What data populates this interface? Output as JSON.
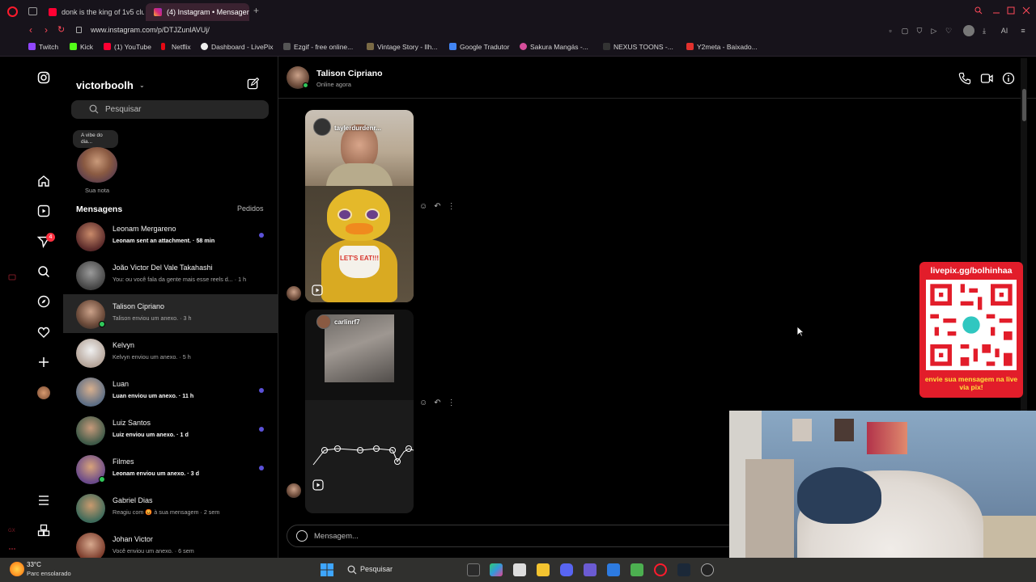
{
  "browser": {
    "tabs": [
      {
        "label": "donk is the king of 1v5 clu",
        "active": false
      },
      {
        "label": "(4) Instagram • Mensagen",
        "active": true
      }
    ],
    "url": "www.instagram.com/p/DTJZunlAVUj/",
    "ext_label": "AI",
    "bookmarks": [
      "Twitch",
      "Kick",
      "(1) YouTube",
      "Netflix",
      "Dashboard - LivePix",
      "Ezgif - free online...",
      "Vintage Story - Ilh...",
      "Google Tradutor",
      "Sakura Mangás -...",
      "NEXUS TOONS -...",
      "Y2meta - Baixado..."
    ]
  },
  "nav": {
    "notification_count": "4"
  },
  "inbox": {
    "username": "victorboolh",
    "search_placeholder": "Pesquisar",
    "note_text": "A vibe do dia...",
    "note_label": "Sua nota",
    "section_title": "Mensagens",
    "requests_label": "Pedidos",
    "conversations": [
      {
        "name": "Leonam Mergareno",
        "preview": "Leonam sent an attachment. · 58 min",
        "unread": true,
        "online": false,
        "selected": false
      },
      {
        "name": "João Victor Del Vale Takahashi",
        "preview": "You: ou você fala da gente mais esse reels d... · 1 h",
        "unread": false,
        "online": false,
        "selected": false
      },
      {
        "name": "Talison Cipriano",
        "preview": "Talison enviou um anexo. · 3 h",
        "unread": false,
        "online": true,
        "selected": true
      },
      {
        "name": "Kelvyn",
        "preview": "Kelvyn enviou um anexo. · 5 h",
        "unread": false,
        "online": false,
        "selected": false
      },
      {
        "name": "Luan",
        "preview": "Luan enviou um anexo. · 11 h",
        "unread": true,
        "online": false,
        "selected": false
      },
      {
        "name": "Luiz Santos",
        "preview": "Luiz enviou um anexo. · 1 d",
        "unread": true,
        "online": false,
        "selected": false
      },
      {
        "name": "Filmes",
        "preview": "Leonam enviou um anexo. · 3 d",
        "unread": true,
        "online": true,
        "selected": false
      },
      {
        "name": "Gabriel Dias",
        "preview": "Reagiu com 😡 à sua mensagem · 2 sem",
        "unread": false,
        "online": false,
        "selected": false
      },
      {
        "name": "Johan Victor",
        "preview": "Você enviou um anexo. · 6 sem",
        "unread": false,
        "online": false,
        "selected": false
      }
    ]
  },
  "chat": {
    "contact_name": "Talison Cipriano",
    "contact_status": "Online agora",
    "messages": [
      {
        "sender_tag": "taylerdurdenr...",
        "overlay_text": "LET'S EAT!!!"
      },
      {
        "sender_tag": "carlinrf7"
      }
    ],
    "composer_placeholder": "Mensagem..."
  },
  "overlay": {
    "qr_title": "livepix.gg/bolhinhaa",
    "qr_subtitle": "envie sua mensagem na live via pix!"
  },
  "taskbar": {
    "temperature": "33°C",
    "weather": "Parc ensolarado",
    "search_label": "Pesquisar"
  },
  "colors": {
    "accent_red": "#e21d2a",
    "unread_dot": "#5b51d8",
    "online_green": "#31c75a",
    "qr_subtitle": "#ffe23b"
  }
}
